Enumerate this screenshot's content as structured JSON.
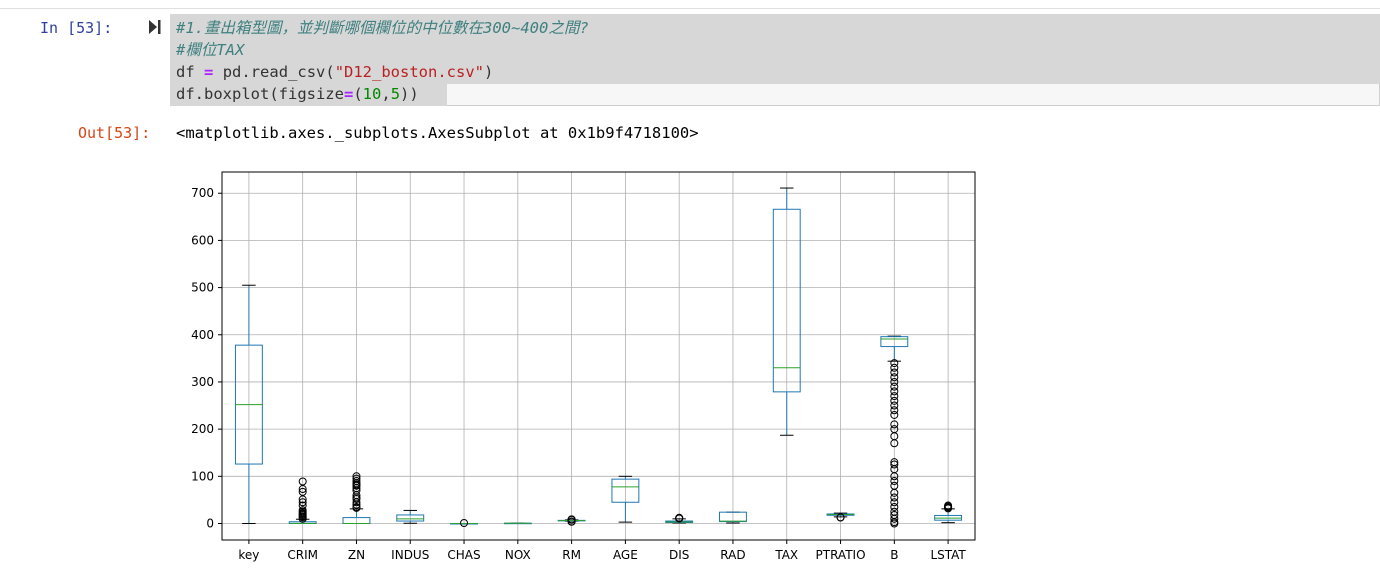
{
  "cell": {
    "in_prompt": "In [53]:",
    "out_prompt": "Out[53]:",
    "code": {
      "comment1": "#1.畫出箱型圖，並判斷哪個欄位的中位數在300~400之間?",
      "comment2": "#欄位TAX",
      "line3_var": "df",
      "line3_eq": "=",
      "line3_call": "pd.read_csv(",
      "line3_str": "\"D12_boston.csv\"",
      "line3_close": ")",
      "line4_call": "df.boxplot(figsize",
      "line4_eq": "=",
      "line4_open": "(",
      "line4_n1": "10",
      "line4_comma": ",",
      "line4_n2": "5",
      "line4_close": "))"
    },
    "output_text": "<matplotlib.axes._subplots.AxesSubplot at 0x1b9f4718100>"
  },
  "chart_data": {
    "type": "boxplot",
    "ylim": [
      -35,
      745
    ],
    "yticks": [
      0,
      100,
      200,
      300,
      400,
      500,
      600,
      700
    ],
    "grid": true,
    "box_color": "#1f77b4",
    "median_color": "#2ca02c",
    "categories": [
      "key",
      "CRIM",
      "ZN",
      "INDUS",
      "CHAS",
      "NOX",
      "RM",
      "AGE",
      "DIS",
      "RAD",
      "TAX",
      "PTRATIO",
      "B",
      "LSTAT"
    ],
    "boxes": [
      {
        "name": "key",
        "whislo": 0,
        "q1": 126,
        "med": 252,
        "q3": 378,
        "whishi": 505,
        "fliers": []
      },
      {
        "name": "CRIM",
        "whislo": 0,
        "q1": 0.1,
        "med": 0.3,
        "q3": 3.7,
        "whishi": 9,
        "fliers": [
          10,
          13,
          15,
          18,
          20,
          22,
          25,
          28,
          38,
          45,
          51,
          67,
          73,
          89
        ]
      },
      {
        "name": "ZN",
        "whislo": 0,
        "q1": 0,
        "med": 0,
        "q3": 12.5,
        "whishi": 31,
        "fliers": [
          33,
          35,
          40,
          45,
          52,
          55,
          60,
          70,
          75,
          80,
          82,
          85,
          90,
          95,
          100
        ]
      },
      {
        "name": "INDUS",
        "whislo": 0.5,
        "q1": 5.2,
        "med": 9.7,
        "q3": 18.1,
        "whishi": 27.7,
        "fliers": []
      },
      {
        "name": "CHAS",
        "whislo": 0,
        "q1": 0,
        "med": 0,
        "q3": 0,
        "whishi": 0,
        "fliers": [
          1
        ]
      },
      {
        "name": "NOX",
        "whislo": 0.4,
        "q1": 0.45,
        "med": 0.54,
        "q3": 0.62,
        "whishi": 0.87,
        "fliers": []
      },
      {
        "name": "RM",
        "whislo": 4.9,
        "q1": 5.9,
        "med": 6.2,
        "q3": 6.6,
        "whishi": 7.7,
        "fliers": [
          3.6,
          4.1,
          8.0,
          8.4,
          8.8
        ]
      },
      {
        "name": "AGE",
        "whislo": 2.9,
        "q1": 45,
        "med": 77.5,
        "q3": 94,
        "whishi": 100,
        "fliers": []
      },
      {
        "name": "DIS",
        "whislo": 1.1,
        "q1": 2.1,
        "med": 3.2,
        "q3": 5.2,
        "whishi": 9.8,
        "fliers": [
          10.6,
          11,
          12.1
        ]
      },
      {
        "name": "RAD",
        "whislo": 1,
        "q1": 4,
        "med": 5,
        "q3": 24,
        "whishi": 24,
        "fliers": []
      },
      {
        "name": "TAX",
        "whislo": 187,
        "q1": 279,
        "med": 330,
        "q3": 666,
        "whishi": 711,
        "fliers": []
      },
      {
        "name": "PTRATIO",
        "whislo": 14,
        "q1": 17.4,
        "med": 19.05,
        "q3": 20.2,
        "whishi": 22,
        "fliers": [
          12.6,
          13
        ]
      },
      {
        "name": "B",
        "whislo": 344,
        "q1": 375,
        "med": 391,
        "q3": 396,
        "whishi": 397,
        "fliers": [
          0,
          3,
          10,
          18,
          25,
          35,
          45,
          55,
          65,
          80,
          90,
          100,
          115,
          125,
          130,
          170,
          185,
          200,
          210,
          230,
          240,
          250,
          260,
          270,
          280,
          290,
          300,
          310,
          320,
          330,
          340
        ]
      },
      {
        "name": "LSTAT",
        "whislo": 1.7,
        "q1": 7,
        "med": 11.4,
        "q3": 17,
        "whishi": 31,
        "fliers": [
          32,
          34,
          36,
          38
        ]
      }
    ]
  }
}
